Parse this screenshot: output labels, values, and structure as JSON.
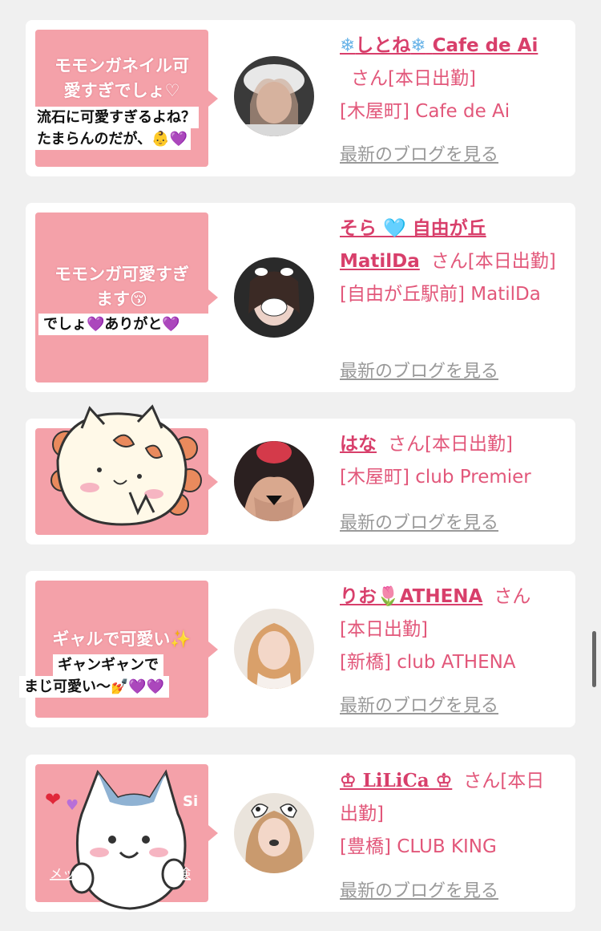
{
  "entries": [
    {
      "bubble_lines": [
        "モモンガネイル可",
        "愛すぎでしょ♡"
      ],
      "caption_lines": [
        "流石に可愛すぎるよね？",
        "たまらんのだが、👶💜"
      ],
      "name_prefix": "❄",
      "name": "しとね",
      "name_mid": "❄",
      "name_rest": "Cafe de Ai",
      "san": "さん",
      "status": "[本日出勤]",
      "store": "[木屋町] Cafe de Ai",
      "blog_link": "最新のブログを見る"
    },
    {
      "bubble_lines": [
        "モモンガ可愛すぎ",
        "ます😚"
      ],
      "caption_lines": [
        "でしょ💜ありがと💜"
      ],
      "name": "そら 🩵 自由が丘",
      "name_rest": "MatilDa",
      "san": "さん",
      "status": "[本日出勤]",
      "store": "[自由が丘駅前] MatilDa",
      "blog_link": "最新のブログを見る"
    },
    {
      "sticker": "hachiware-style-sticker",
      "name": "はな",
      "san": "さん",
      "status": "[本日出勤]",
      "store": "[木屋町] club Premier",
      "blog_link": "最新のブログを見る"
    },
    {
      "bubble_lines": [
        "ギャルで可愛い✨"
      ],
      "caption_lines": [
        "ギャンギャンで",
        "まじ可愛い〜💅💜💜"
      ],
      "name": "りお🌷ATHENA",
      "san": "さん",
      "status": "[本日出勤]",
      "store": "[新橋] club ATHENA",
      "blog_link": "最新のブログを見る"
    },
    {
      "sticker": "hachiware-cat-sticker",
      "name": "♔ LiLiCa ♔",
      "san": "さん",
      "status": "[本日出勤]",
      "store": "[豊橋] CLUB KING",
      "blog_link": "最新のブログを見る"
    }
  ],
  "colors": {
    "page_bg": "#f0f0f0",
    "bubble": "#f4a1a9",
    "name": "#d83f6b",
    "info": "#e2577a",
    "link": "#999999"
  }
}
